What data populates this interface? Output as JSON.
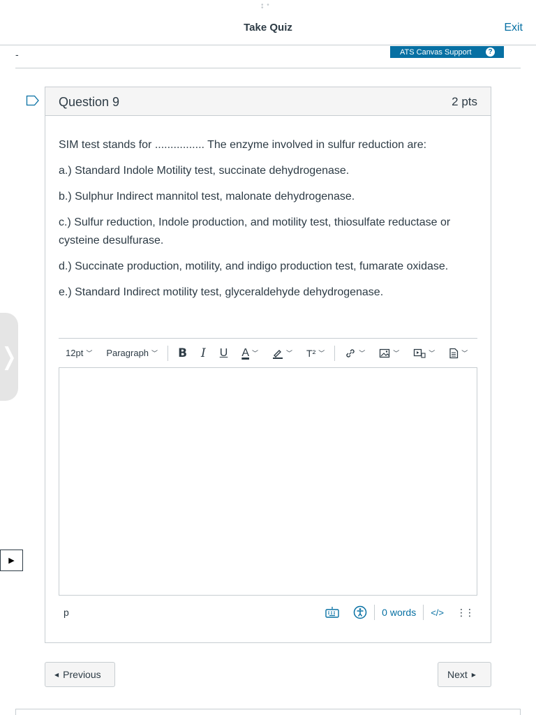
{
  "header": {
    "title": "Take Quiz",
    "exit_label": "Exit"
  },
  "subheader": {
    "dash": "-",
    "support_label": "ATS Canvas Support",
    "help_glyph": "?"
  },
  "question": {
    "title": "Question 9",
    "points": "2 pts",
    "stem": "SIM test stands for ................ The enzyme involved in sulfur reduction are:",
    "options": [
      "a.) Standard Indole Motility test, succinate dehydrogenase.",
      "b.) Sulphur Indirect mannitol test, malonate dehydrogenase.",
      "c.) Sulfur reduction,  Indole production, and motility test, thiosulfate reductase or cysteine desulfurase.",
      "d.) Succinate production, motility, and indigo production test, fumarate oxidase.",
      "e.) Standard Indirect motility test, glyceraldehyde dehydrogenase."
    ]
  },
  "editor": {
    "font_size": "12pt",
    "block_format": "Paragraph",
    "superscript_label": "T²",
    "element_path": "p",
    "word_count": "0 words",
    "html_toggle": "</>"
  },
  "nav": {
    "previous_label": "Previous",
    "next_label": "Next"
  },
  "colors": {
    "accent": "#0770a3",
    "border": "#c7cdd1",
    "text": "#2d3b45"
  }
}
